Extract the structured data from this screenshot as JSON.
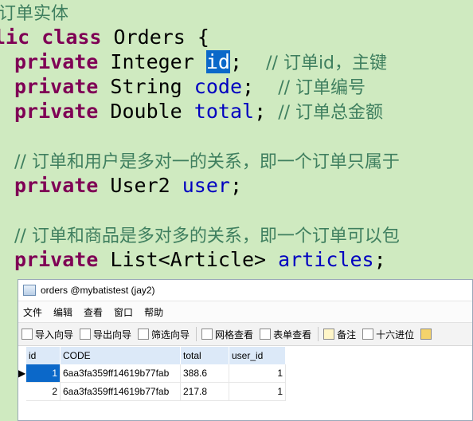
{
  "code": {
    "line0": "订单实体",
    "line1_kw1": "lic",
    "line1_kw2": "class",
    "line1_name": "Orders {",
    "line2_kw": "private",
    "line2_type": "Integer",
    "line2_field": "id",
    "line2_rest": ";",
    "line2_comment": "// 订单id，主键",
    "line3_kw": "private",
    "line3_type": "String",
    "line3_field": "code",
    "line3_rest": ";",
    "line3_comment": "// 订单编号",
    "line4_kw": "private",
    "line4_type": "Double",
    "line4_field": "total",
    "line4_rest": ";",
    "line4_comment": "// 订单总金额",
    "line6_comment": "// 订单和用户是多对一的关系，即一个订单只属于",
    "line7_kw": "private",
    "line7_type": "User2",
    "line7_field": "user",
    "line7_rest": ";",
    "line9_comment": "// 订单和商品是多对多的关系，即一个订单可以包",
    "line10_kw": "private",
    "line10_type": "List<Article>",
    "line10_field": "articles",
    "line10_rest": ";"
  },
  "window": {
    "title": "orders @mybatistest (jay2)",
    "menu": [
      "文件",
      "编辑",
      "查看",
      "窗口",
      "帮助"
    ],
    "toolbar": [
      "导入向导",
      "导出向导",
      "筛选向导",
      "网格查看",
      "表单查看",
      "备注",
      "十六进位"
    ],
    "columns": [
      "id",
      "CODE",
      "total",
      "user_id"
    ],
    "rows": [
      {
        "id": "1",
        "code": "6aa3fa359ff14619b77fab",
        "total": "388.6",
        "user_id": "1"
      },
      {
        "id": "2",
        "code": "6aa3fa359ff14619b77fab",
        "total": "217.8",
        "user_id": "1"
      }
    ]
  }
}
